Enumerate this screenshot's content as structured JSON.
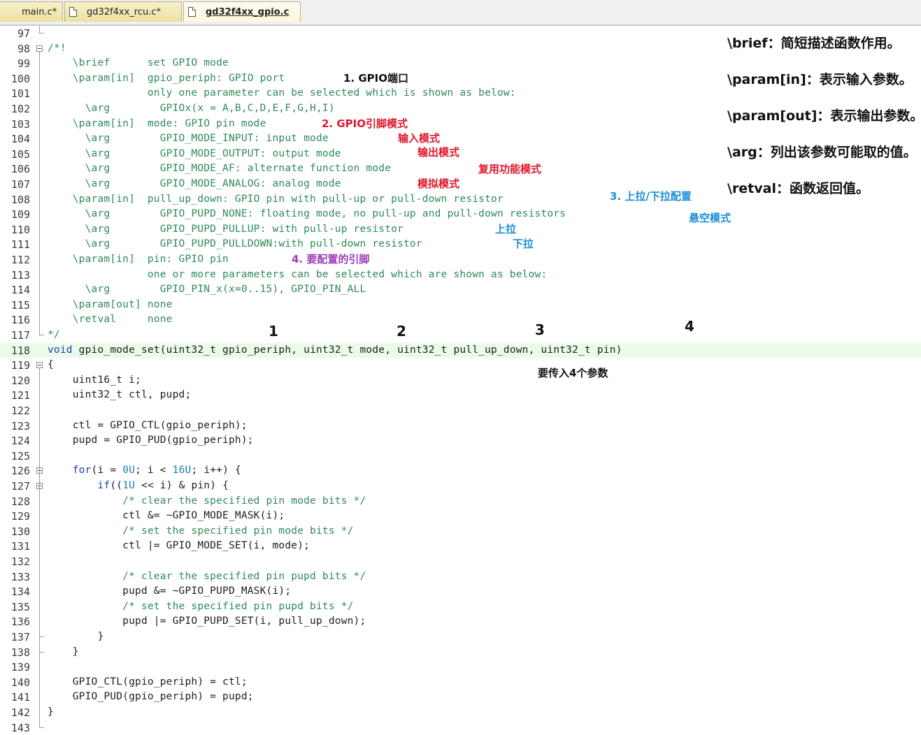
{
  "tabs": [
    {
      "label": "main.c*"
    },
    {
      "label": "gd32f4xx_rcu.c*"
    },
    {
      "label": "gd32f4xx_gpio.c"
    }
  ],
  "lines": [
    {
      "n": "97",
      "t": ""
    },
    {
      "n": "98",
      "t": "/*!"
    },
    {
      "n": "99",
      "t": "    \\brief      set GPIO mode"
    },
    {
      "n": "100",
      "t": "    \\param[in]  gpio_periph: GPIO port"
    },
    {
      "n": "101",
      "t": "                only one parameter can be selected which is shown as below:"
    },
    {
      "n": "102",
      "t": "      \\arg        GPIOx(x = A,B,C,D,E,F,G,H,I)"
    },
    {
      "n": "103",
      "t": "    \\param[in]  mode: GPIO pin mode"
    },
    {
      "n": "104",
      "t": "      \\arg        GPIO_MODE_INPUT: input mode"
    },
    {
      "n": "105",
      "t": "      \\arg        GPIO_MODE_OUTPUT: output mode"
    },
    {
      "n": "106",
      "t": "      \\arg        GPIO_MODE_AF: alternate function mode"
    },
    {
      "n": "107",
      "t": "      \\arg        GPIO_MODE_ANALOG: analog mode"
    },
    {
      "n": "108",
      "t": "    \\param[in]  pull_up_down: GPIO pin with pull-up or pull-down resistor"
    },
    {
      "n": "109",
      "t": "      \\arg        GPIO_PUPD_NONE: floating mode, no pull-up and pull-down resistors"
    },
    {
      "n": "110",
      "t": "      \\arg        GPIO_PUPD_PULLUP: with pull-up resistor"
    },
    {
      "n": "111",
      "t": "      \\arg        GPIO_PUPD_PULLDOWN:with pull-down resistor"
    },
    {
      "n": "112",
      "t": "    \\param[in]  pin: GPIO pin"
    },
    {
      "n": "113",
      "t": "                one or more parameters can be selected which are shown as below:"
    },
    {
      "n": "114",
      "t": "      \\arg        GPIO_PIN_x(x=0..15), GPIO_PIN_ALL"
    },
    {
      "n": "115",
      "t": "    \\param[out] none"
    },
    {
      "n": "116",
      "t": "    \\retval     none"
    },
    {
      "n": "117",
      "t": "*/"
    },
    {
      "n": "118",
      "t": "void gpio_mode_set(uint32_t gpio_periph, uint32_t mode, uint32_t pull_up_down, uint32_t pin)"
    },
    {
      "n": "119",
      "t": "{"
    },
    {
      "n": "120",
      "t": "    uint16_t i;"
    },
    {
      "n": "121",
      "t": "    uint32_t ctl, pupd;"
    },
    {
      "n": "122",
      "t": ""
    },
    {
      "n": "123",
      "t": "    ctl = GPIO_CTL(gpio_periph);"
    },
    {
      "n": "124",
      "t": "    pupd = GPIO_PUD(gpio_periph);"
    },
    {
      "n": "125",
      "t": ""
    },
    {
      "n": "126",
      "t": "    for(i = 0U; i < 16U; i++) {"
    },
    {
      "n": "127",
      "t": "        if((1U << i) & pin) {"
    },
    {
      "n": "128",
      "t": "            /* clear the specified pin mode bits */"
    },
    {
      "n": "129",
      "t": "            ctl &= ~GPIO_MODE_MASK(i);"
    },
    {
      "n": "130",
      "t": "            /* set the specified pin mode bits */"
    },
    {
      "n": "131",
      "t": "            ctl |= GPIO_MODE_SET(i, mode);"
    },
    {
      "n": "132",
      "t": ""
    },
    {
      "n": "133",
      "t": "            /* clear the specified pin pupd bits */"
    },
    {
      "n": "134",
      "t": "            pupd &= ~GPIO_PUPD_MASK(i);"
    },
    {
      "n": "135",
      "t": "            /* set the specified pin pupd bits */"
    },
    {
      "n": "136",
      "t": "            pupd |= GPIO_PUPD_SET(i, pull_up_down);"
    },
    {
      "n": "137",
      "t": "        }"
    },
    {
      "n": "138",
      "t": "    }"
    },
    {
      "n": "139",
      "t": ""
    },
    {
      "n": "140",
      "t": "    GPIO_CTL(gpio_periph) = ctl;"
    },
    {
      "n": "141",
      "t": "    GPIO_PUD(gpio_periph) = pupd;"
    },
    {
      "n": "142",
      "t": "}"
    },
    {
      "n": "143",
      "t": ""
    }
  ],
  "annotations": {
    "a_port": "1. GPIO端口",
    "a_mode": "2. GPIO引脚模式",
    "a_input": "输入模式",
    "a_output": "输出模式",
    "a_af": "复用功能模式",
    "a_analog": "模拟模式",
    "a_pull": "3. 上拉/下拉配置",
    "a_float": "悬空模式",
    "a_pullup": "上拉",
    "a_pulldown": "下拉",
    "a_pin": "4. 要配置的引脚",
    "n1": "1",
    "n2": "2",
    "n3": "3",
    "n4": "4",
    "four_params": "要传入4个参数"
  },
  "legend": {
    "brief": "\\brief：简短描述函数作用。",
    "param_in": "\\param[in]：表示输入参数。",
    "param_out": "\\param[out]：表示输出参数。",
    "arg": "\\arg：列出该参数可能取的值。",
    "retval": "\\retval：函数返回值。"
  },
  "colors": {
    "comment": "#2e8b57",
    "keyword": "#1a3fb0",
    "highlight_line": "#ebfbea",
    "anno_red": "#e0182d",
    "anno_blue": "#1a8fd8",
    "anno_purple": "#9b3fb8"
  }
}
